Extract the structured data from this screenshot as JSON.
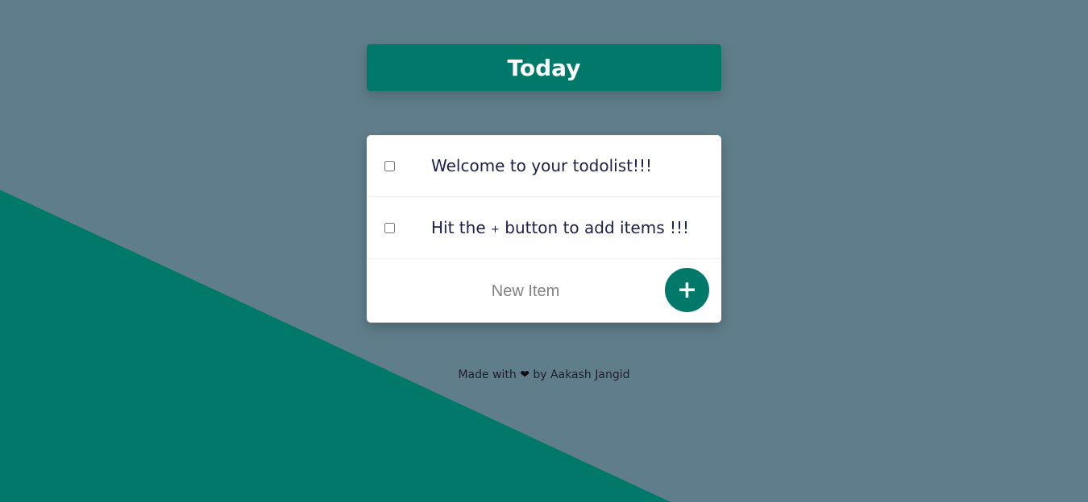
{
  "colors": {
    "background": "#607d8b",
    "accent": "#00796b",
    "card": "#ffffff",
    "item_text": "#1a1f4a"
  },
  "heading": {
    "title": "Today"
  },
  "items": [
    {
      "text": "Welcome to your todolist!!!",
      "checked": false
    },
    {
      "text_before": "Hit the",
      "plus": "+",
      "text_after": "button to add items !!!",
      "checked": false
    }
  ],
  "form": {
    "placeholder": "New Item",
    "add_label": "+"
  },
  "footer": {
    "prefix": "Made with",
    "heart": "❤",
    "suffix": "by Aakash Jangid"
  }
}
